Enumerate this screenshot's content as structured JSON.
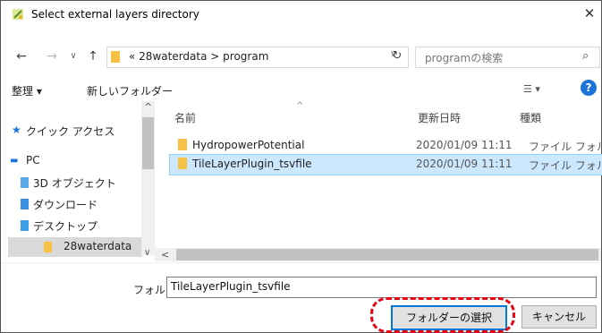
{
  "window": {
    "title": "Select external layers directory",
    "close_glyph": "✕"
  },
  "nav": {
    "back_glyph": "←",
    "forward_glyph": "→",
    "recent_glyph": "∨",
    "up_glyph": "↑",
    "breadcrumb_prefix": "«",
    "breadcrumb": [
      "28waterdata",
      "program"
    ],
    "breadcrumb_sep": ">",
    "refresh_glyph": "↻",
    "dropdown_glyph": "∨",
    "search_placeholder": "programの検索",
    "search_glyph": "⌕"
  },
  "toolbar": {
    "organize": "整理 ▾",
    "new_folder": "新しいフォルダー",
    "view_glyph": "☰ ▾",
    "help_glyph": "?"
  },
  "sidebar": {
    "items": [
      {
        "label": "クイック アクセス",
        "icon": "star-icon"
      },
      {
        "label": "PC",
        "icon": "pc-icon"
      },
      {
        "label": "3D オブジェクト",
        "icon": "3d-objects-icon"
      },
      {
        "label": "ダウンロード",
        "icon": "download-icon"
      },
      {
        "label": "デスクトップ",
        "icon": "desktop-icon"
      },
      {
        "label": "28waterdata",
        "icon": "folder-icon",
        "selected": true
      }
    ],
    "scroll_up_glyph": "^",
    "scroll_down_glyph": "∨"
  },
  "list": {
    "columns": {
      "name": "名前",
      "date": "更新日時",
      "type": "種類"
    },
    "sort_glyph": "^",
    "rows": [
      {
        "name": "HydropowerPotential",
        "date": "2020/01/09 11:11",
        "type": "ファイル フォルダー",
        "selected": false
      },
      {
        "name": "TileLayerPlugin_tsvfile",
        "date": "2020/01/09 11:11",
        "type": "ファイル フォルダー",
        "selected": true
      }
    ],
    "hscroll_left_glyph": "<",
    "hscroll_right_glyph": ">"
  },
  "footer": {
    "folder_label": "フォルダー:",
    "folder_value": "TileLayerPlugin_tsvfile",
    "select_button": "フォルダーの選択",
    "cancel_button": "キャンセル"
  },
  "colors": {
    "selection": "#cce8ff",
    "folder": "#f6c144",
    "annotation": "#e60012",
    "help": "#1a73d9"
  }
}
